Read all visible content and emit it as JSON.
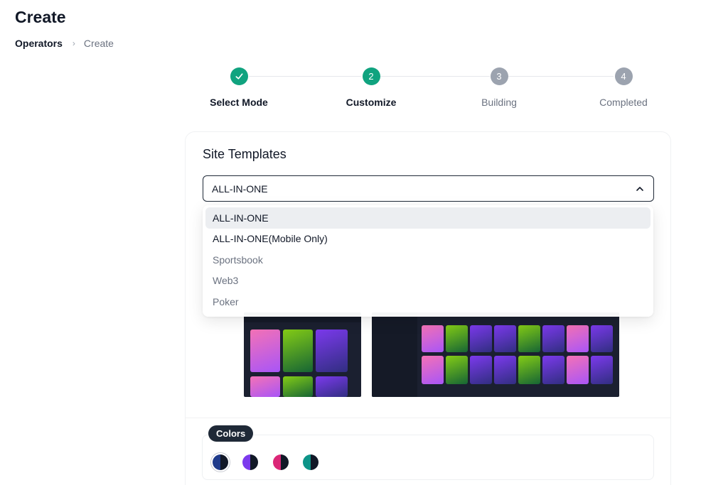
{
  "page": {
    "title": "Create"
  },
  "breadcrumb": {
    "parent": "Operators",
    "separator": "›",
    "current": "Create"
  },
  "stepper": {
    "steps": [
      {
        "number": "",
        "label": "Select Mode",
        "status": "completed"
      },
      {
        "number": "2",
        "label": "Customize",
        "status": "active"
      },
      {
        "number": "3",
        "label": "Building",
        "status": "pending"
      },
      {
        "number": "4",
        "label": "Completed",
        "status": "pending"
      }
    ]
  },
  "templates": {
    "title": "Site Templates",
    "selected": "ALL-IN-ONE",
    "options": [
      "ALL-IN-ONE",
      "ALL-IN-ONE(Mobile Only)",
      "Sportsbook",
      "Web3",
      "Poker"
    ]
  },
  "colors": {
    "label": "Colors",
    "swatches": [
      {
        "left": "#1e3a8a",
        "right": "#111827",
        "selected": true
      },
      {
        "left": "#7c3aed",
        "right": "#111827",
        "selected": false
      },
      {
        "left": "#db2777",
        "right": "#111827",
        "selected": false
      },
      {
        "left": "#0d9488",
        "right": "#111827",
        "selected": false
      }
    ]
  }
}
